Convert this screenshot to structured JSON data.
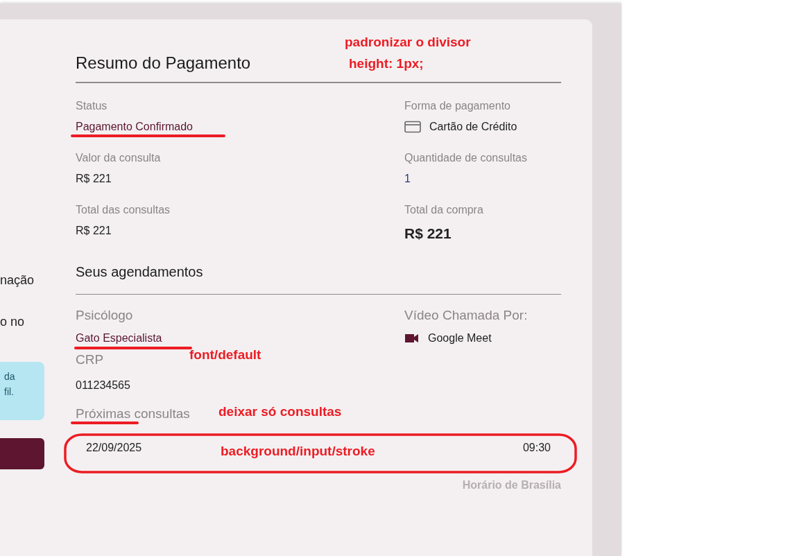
{
  "left_panel": {
    "texts": [
      "nação",
      "o no"
    ],
    "info_box": {
      "lines": [
        "da",
        "fil."
      ]
    }
  },
  "payment": {
    "title": "Resumo do Pagamento",
    "fields": [
      {
        "label": "Status",
        "value": "Pagamento Confirmado",
        "kind": "status"
      },
      {
        "label": "Forma de pagamento",
        "value": "Cartão de Crédito",
        "kind": "card"
      },
      {
        "label": "Valor da consulta",
        "value": "R$ 221",
        "kind": "plain"
      },
      {
        "label": "Quantidade de consultas",
        "value": "1",
        "kind": "count"
      },
      {
        "label": "Total das consultas",
        "value": "R$ 221",
        "kind": "plain"
      },
      {
        "label": "Total da compra",
        "value": "R$ 221",
        "kind": "total"
      }
    ]
  },
  "appointments": {
    "title": "Seus agendamentos",
    "psychologist_label": "Psicólogo",
    "psychologist": "Gato Especialista",
    "video_label": "Vídeo Chamada Por:",
    "video_platform": "Google Meet",
    "crp_label": "CRP",
    "crp": "011234565",
    "upcoming_label": "Próximas consultas",
    "sessions": [
      {
        "date": "22/09/2025",
        "time": "09:30"
      }
    ],
    "timezone_note": "Horário de Brasília"
  },
  "annotations": [
    {
      "kind": "text",
      "text": "padronizar o divisor"
    },
    {
      "kind": "text",
      "text": "height: 1px;"
    },
    {
      "kind": "underline"
    },
    {
      "kind": "underline"
    },
    {
      "kind": "text",
      "text": "font/default"
    },
    {
      "kind": "underline"
    },
    {
      "kind": "text",
      "text": "deixar só consultas"
    },
    {
      "kind": "ellipse"
    },
    {
      "kind": "text",
      "text": "background/input/stroke"
    }
  ]
}
